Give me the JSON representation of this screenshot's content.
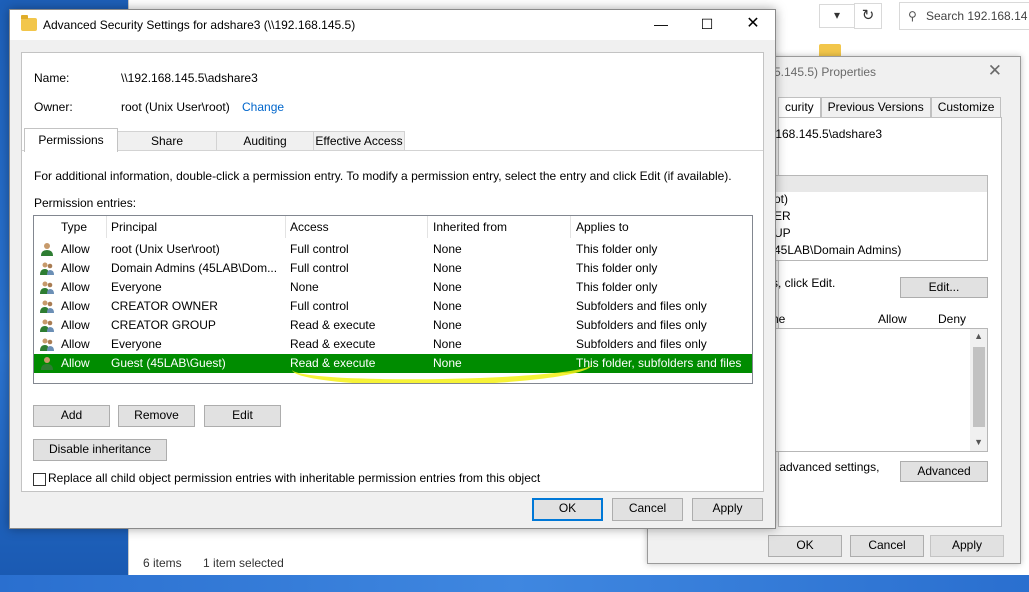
{
  "explorer": {
    "search_placeholder": "Search 192.168.14",
    "refresh_glyph": "↻",
    "dropdown_glyph": "▾",
    "status_items": "6 items",
    "status_selected": "1 item selected"
  },
  "properties": {
    "title": "5.145.5) Properties",
    "tabs": [
      "curity",
      "Previous Versions",
      "Customize"
    ],
    "object_name": ".168.145.5\\adshare3",
    "principals": [
      "ot)",
      "ER",
      "UP",
      "45LAB\\Domain Admins)"
    ],
    "edit_hint": "s, click Edit.",
    "edit_label": "Edit...",
    "perm_col_name": "ne",
    "perm_col_allow": "Allow",
    "perm_col_deny": "Deny",
    "advanced_hint": "r advanced settings,",
    "advanced_label": "Advanced",
    "ok_label": "OK",
    "cancel_label": "Cancel",
    "apply_label": "Apply"
  },
  "dialog": {
    "title": "Advanced Security Settings for adshare3 (\\\\192.168.145.5)",
    "name_label": "Name:",
    "name_value": "\\\\192.168.145.5\\adshare3",
    "owner_label": "Owner:",
    "owner_value": "root (Unix User\\root)",
    "owner_change": "Change",
    "tabs": [
      "Permissions",
      "Share",
      "Auditing",
      "Effective Access"
    ],
    "info_text": "For additional information, double-click a permission entry. To modify a permission entry, select the entry and click Edit (if available).",
    "entries_label": "Permission entries:",
    "columns": [
      "Type",
      "Principal",
      "Access",
      "Inherited from",
      "Applies to"
    ],
    "entries": [
      {
        "type": "Allow",
        "principal": "root (Unix User\\root)",
        "access": "Full control",
        "inherited": "None",
        "applies": "This folder only",
        "icon": "user-icon"
      },
      {
        "type": "Allow",
        "principal": "Domain Admins (45LAB\\Dom...",
        "access": "Full control",
        "inherited": "None",
        "applies": "This folder only",
        "icon": "group-icon"
      },
      {
        "type": "Allow",
        "principal": "Everyone",
        "access": "None",
        "inherited": "None",
        "applies": "This folder only",
        "icon": "group-icon"
      },
      {
        "type": "Allow",
        "principal": "CREATOR OWNER",
        "access": "Full control",
        "inherited": "None",
        "applies": "Subfolders and files only",
        "icon": "group-icon"
      },
      {
        "type": "Allow",
        "principal": "CREATOR GROUP",
        "access": "Read & execute",
        "inherited": "None",
        "applies": "Subfolders and files only",
        "icon": "group-icon"
      },
      {
        "type": "Allow",
        "principal": "Everyone",
        "access": "Read & execute",
        "inherited": "None",
        "applies": "Subfolders and files only",
        "icon": "group-icon"
      },
      {
        "type": "Allow",
        "principal": "Guest (45LAB\\Guest)",
        "access": "Read & execute",
        "inherited": "None",
        "applies": "This folder, subfolders and files",
        "icon": "user-icon",
        "selected": true
      }
    ],
    "add_label": "Add",
    "remove_label": "Remove",
    "edit_label": "Edit",
    "disable_inheritance_label": "Disable inheritance",
    "replace_label": "Replace all child object permission entries with inheritable permission entries from this object",
    "ok_label": "OK",
    "cancel_label": "Cancel",
    "apply_label": "Apply",
    "selection_color": "#008c00",
    "highlight_color": "#f5f014"
  }
}
